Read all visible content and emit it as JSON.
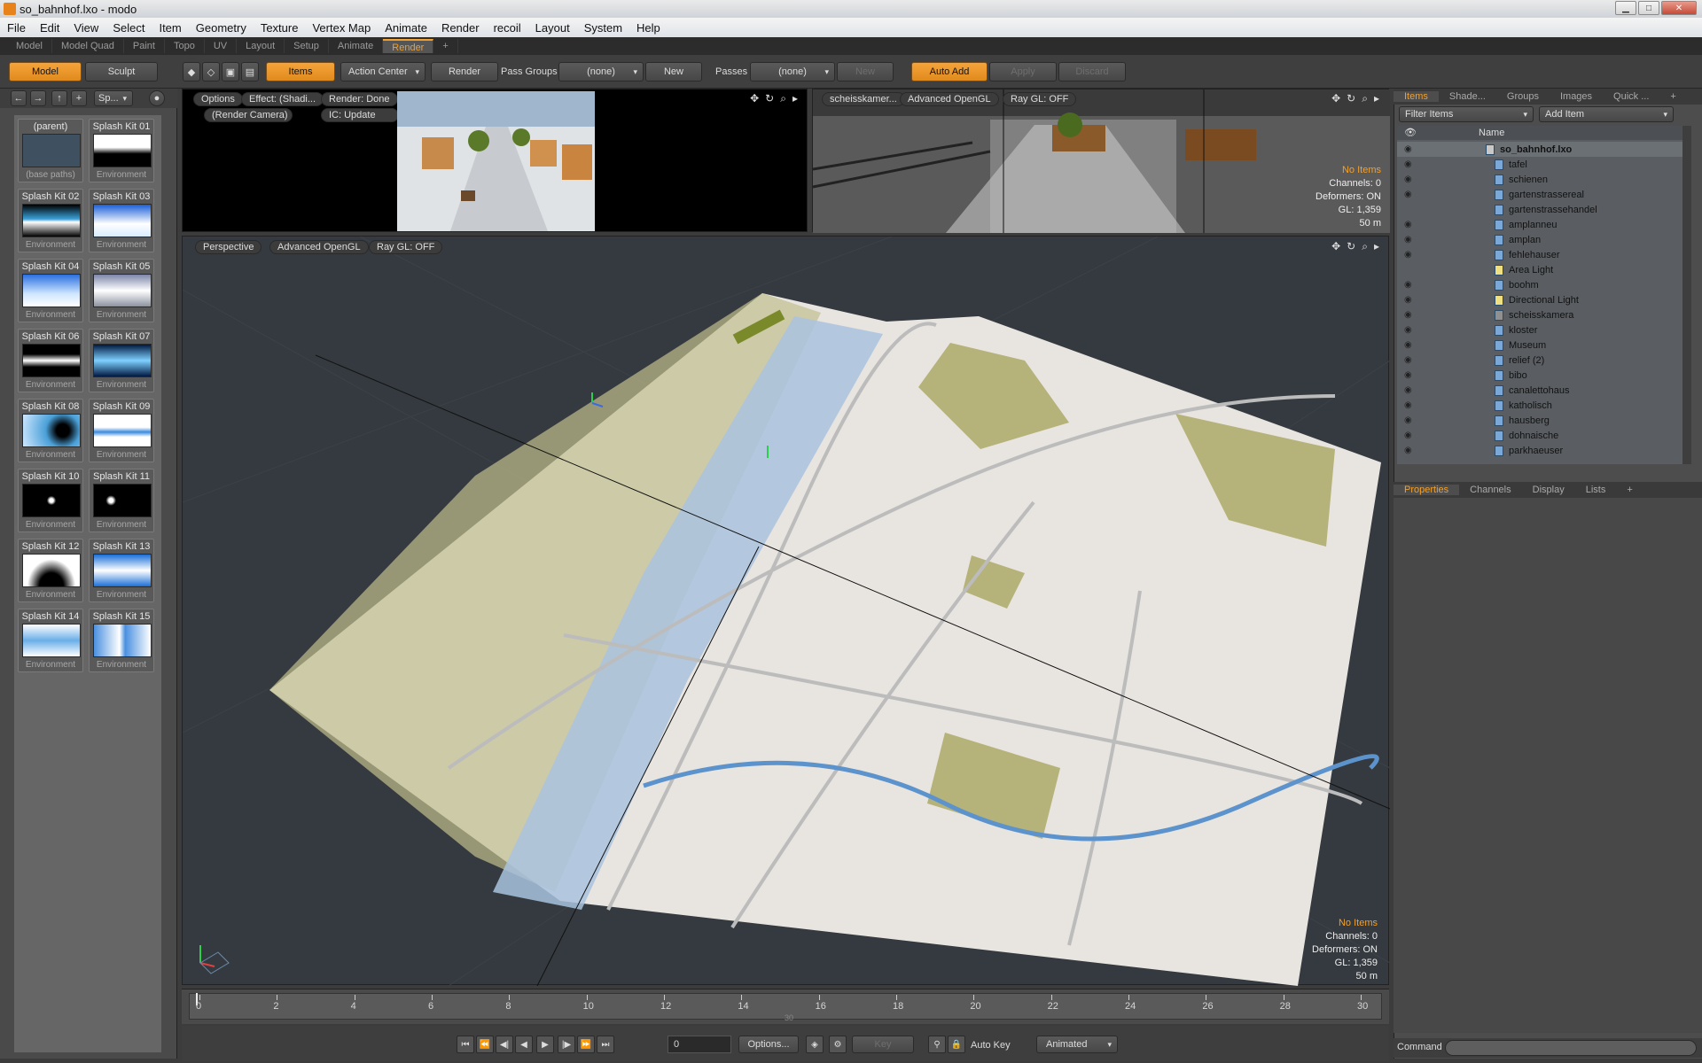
{
  "window": {
    "title": "so_bahnhof.lxo - modo"
  },
  "menu": [
    "File",
    "Edit",
    "View",
    "Select",
    "Item",
    "Geometry",
    "Texture",
    "Vertex Map",
    "Animate",
    "Render",
    "recoil",
    "Layout",
    "System",
    "Help"
  ],
  "layout_tabs": [
    "Model",
    "Model Quad",
    "Paint",
    "Topo",
    "UV",
    "Layout",
    "Setup",
    "Animate",
    "Render",
    "+"
  ],
  "toolbar": {
    "model": "Model",
    "sculpt": "Sculpt",
    "items": "Items",
    "action_center": "Action Center",
    "render": "Render",
    "pass_groups": "Pass Groups",
    "pass_groups_value": "(none)",
    "new1": "New",
    "passes": "Passes",
    "passes_value": "(none)",
    "new2": "New",
    "auto_add": "Auto Add",
    "apply": "Apply",
    "discard": "Discard"
  },
  "presets": {
    "dropdown": "Sp...",
    "items": [
      {
        "name": "(parent)",
        "type": "(base paths)",
        "grad": "#3f5060"
      },
      {
        "name": "Splash Kit 01",
        "type": "Environment",
        "grad": "linear-gradient(#fff 40%,#000 60%)"
      },
      {
        "name": "Splash Kit 02",
        "type": "Environment",
        "grad": "linear-gradient(#000,#3aa0d8 45%,#fff 55%,#000)"
      },
      {
        "name": "Splash Kit 03",
        "type": "Environment",
        "grad": "linear-gradient(#1a5fd8,#fff 60%,#d8ecff)"
      },
      {
        "name": "Splash Kit 04",
        "type": "Environment",
        "grad": "linear-gradient(#2a6fe0,#cfe6ff 60%,#fff)"
      },
      {
        "name": "Splash Kit 05",
        "type": "Environment",
        "grad": "linear-gradient(#7c86a8,#fff 50%,#8c92a0)"
      },
      {
        "name": "Splash Kit 06",
        "type": "Environment",
        "grad": "linear-gradient(#000 30%,#fff 50%,#000 70%)"
      },
      {
        "name": "Splash Kit 07",
        "type": "Environment",
        "grad": "linear-gradient(#001840,#7fd0ff 50%,#001840)"
      },
      {
        "name": "Splash Kit 08",
        "type": "Environment",
        "grad": "radial-gradient(circle at 70% 50%,#000 15%,#4aa0d8 40%,#cfe8ff)"
      },
      {
        "name": "Splash Kit 09",
        "type": "Environment",
        "grad": "linear-gradient(#fff 40%,#3a8ae0 55%,#fff 70%)"
      },
      {
        "name": "Splash Kit 10",
        "type": "Environment",
        "grad": "radial-gradient(circle at 50% 50%,#fff 6%,#000 14%)"
      },
      {
        "name": "Splash Kit 11",
        "type": "Environment",
        "grad": "radial-gradient(circle at 30% 50%,#fff 5%,#000 12%)"
      },
      {
        "name": "Splash Kit 12",
        "type": "Environment",
        "grad": "radial-gradient(ellipse at 50% 100%,#000 30%,#fff 60%)"
      },
      {
        "name": "Splash Kit 13",
        "type": "Environment",
        "grad": "linear-gradient(#1a6fd8,#fff 50%,#1a6fd8)"
      },
      {
        "name": "Splash Kit 14",
        "type": "Environment",
        "grad": "linear-gradient(#fff,#6aaee8 50%,#fff)"
      },
      {
        "name": "Splash Kit 15",
        "type": "Environment",
        "grad": "linear-gradient(90deg,#4a90e0,#fff 45%,#4a90e0 55%,#fff)"
      }
    ]
  },
  "render_view": {
    "options": "Options",
    "effect": "Effect: (Shadi...",
    "status": "Render: Done",
    "camera": "(Render Camera)",
    "ic": "IC: Update"
  },
  "cam_view": {
    "camera": "scheisskamer...",
    "shading": "Advanced OpenGL",
    "raygl": "Ray GL: OFF",
    "stats": {
      "noitems": "No Items",
      "channels": "Channels: 0",
      "deformers": "Deformers: ON",
      "gl": "GL: 1,359",
      "scale": "50 m"
    }
  },
  "main_view": {
    "projection": "Perspective",
    "shading": "Advanced OpenGL",
    "raygl": "Ray GL: OFF",
    "stats": {
      "noitems": "No Items",
      "channels": "Channels: 0",
      "deformers": "Deformers: ON",
      "gl": "GL: 1,359",
      "scale": "50 m"
    }
  },
  "right_panel": {
    "tabs": [
      "Items",
      "Shade...",
      "Groups",
      "Images",
      "Quick ...",
      "+"
    ],
    "filter": "Filter Items",
    "add_item": "Add Item",
    "col_name": "Name",
    "items": [
      {
        "name": "so_bahnhof.lxo",
        "kind": "scene",
        "bold": true,
        "eye": true
      },
      {
        "name": "tafel",
        "kind": "mesh",
        "eye": true
      },
      {
        "name": "schienen",
        "kind": "mesh",
        "eye": true
      },
      {
        "name": "gartenstrassereal",
        "kind": "mesh",
        "eye": true
      },
      {
        "name": "gartenstrassehandel",
        "kind": "mesh",
        "eye": false
      },
      {
        "name": "amplanneu",
        "kind": "mesh",
        "eye": true
      },
      {
        "name": "amplan",
        "kind": "mesh",
        "eye": true
      },
      {
        "name": "fehlehauser",
        "kind": "mesh",
        "eye": true
      },
      {
        "name": "Area Light",
        "kind": "light",
        "eye": false
      },
      {
        "name": "boohm",
        "kind": "mesh",
        "eye": true
      },
      {
        "name": "Directional Light",
        "kind": "light",
        "eye": true
      },
      {
        "name": "scheisskamera",
        "kind": "camera",
        "eye": true
      },
      {
        "name": "kloster",
        "kind": "mesh",
        "eye": true
      },
      {
        "name": "Museum",
        "kind": "mesh",
        "eye": true
      },
      {
        "name": "relief (2)",
        "kind": "mesh",
        "eye": true
      },
      {
        "name": "bibo",
        "kind": "mesh",
        "eye": true
      },
      {
        "name": "canalettohaus",
        "kind": "mesh",
        "eye": true
      },
      {
        "name": "katholisch",
        "kind": "mesh",
        "eye": true
      },
      {
        "name": "hausberg",
        "kind": "mesh",
        "eye": true
      },
      {
        "name": "dohnaische",
        "kind": "mesh",
        "eye": true
      },
      {
        "name": "parkhaeuser",
        "kind": "mesh",
        "eye": true
      }
    ],
    "prop_tabs": [
      "Properties",
      "Channels",
      "Display",
      "Lists",
      "+"
    ]
  },
  "timeline": {
    "ticks": [
      "0",
      "2",
      "4",
      "6",
      "8",
      "10",
      "12",
      "14",
      "16",
      "18",
      "20",
      "22",
      "24",
      "26",
      "28",
      "30"
    ],
    "sub": "30"
  },
  "transport": {
    "frame": "0",
    "options": "Options...",
    "key": "Key",
    "auto_key": "Auto Key",
    "animated": "Animated"
  },
  "command": {
    "label": "Command"
  }
}
